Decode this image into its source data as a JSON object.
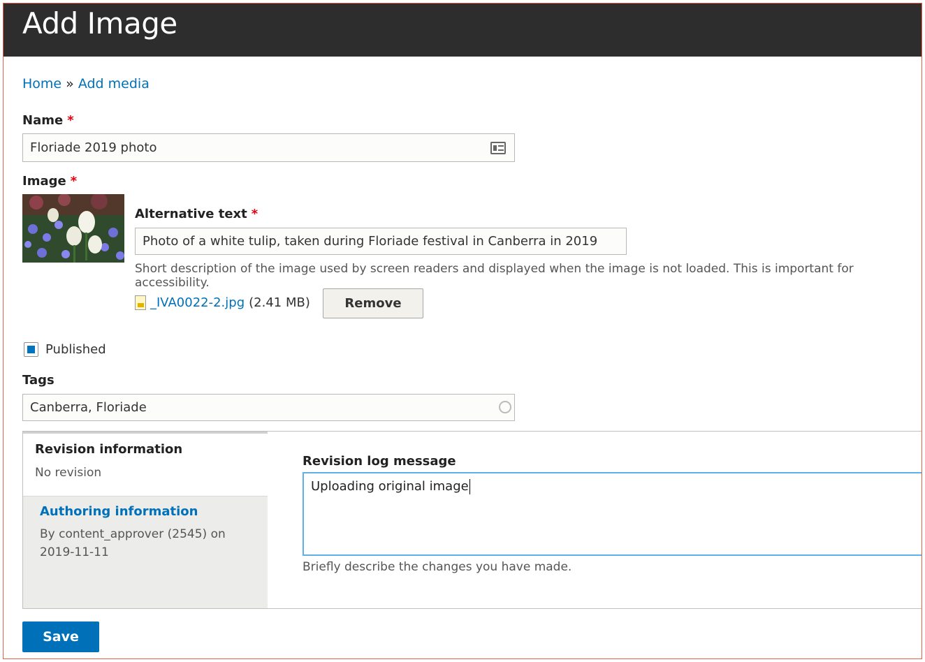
{
  "page": {
    "title": "Add Image"
  },
  "breadcrumb": {
    "home": "Home",
    "separator": "»",
    "current": "Add media"
  },
  "name_field": {
    "label": "Name",
    "required_mark": "*",
    "value": "Floriade 2019 photo"
  },
  "image_field": {
    "label": "Image",
    "required_mark": "*",
    "alt_label": "Alternative text",
    "alt_required_mark": "*",
    "alt_value": "Photo of a white tulip, taken during Floriade festival in Canberra in 2019",
    "alt_description": "Short description of the image used by screen readers and displayed when the image is not loaded. This is important for accessibility.",
    "file_name": "_IVA0022-2.jpg",
    "file_size": "(2.41 MB)",
    "remove_label": "Remove"
  },
  "published": {
    "label": "Published",
    "checked": true
  },
  "tags": {
    "label": "Tags",
    "value": "Canberra, Floriade"
  },
  "vertical_tabs": {
    "tabs": [
      {
        "title": "Revision information",
        "summary": "No revision",
        "active": true
      },
      {
        "title": "Authoring information",
        "summary": "By content_approver (2545) on 2019-11-11",
        "active": false
      }
    ],
    "revision_log_label": "Revision log message",
    "revision_log_value": "Uploading original image",
    "revision_log_description": "Briefly describe the changes you have made."
  },
  "actions": {
    "save_label": "Save"
  },
  "colors": {
    "header_bg": "#2d2d2d",
    "link": "#0071b8",
    "primary_button": "#0071b8",
    "required": "#e3000f",
    "frame_border": "#e2614a"
  }
}
